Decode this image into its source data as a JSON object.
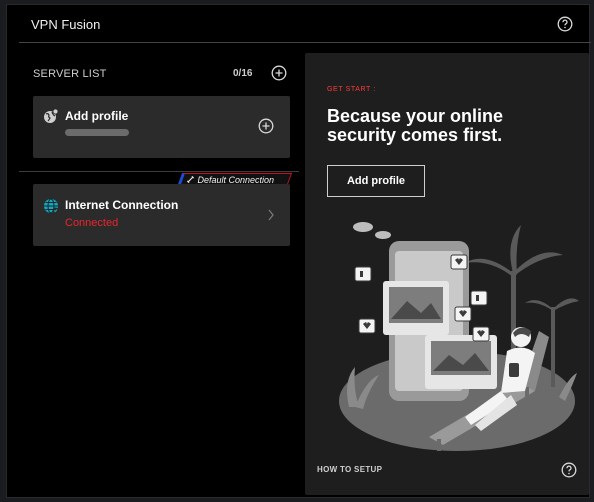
{
  "app": {
    "title": "VPN Fusion"
  },
  "server_list": {
    "label": "SERVER LIST",
    "count": "0/16",
    "add_profile_card": {
      "label": "Add profile"
    },
    "default_badge": "Default Connection",
    "connection_card": {
      "label": "Internet Connection",
      "status": "Connected"
    }
  },
  "promo": {
    "eyebrow": "GET START :",
    "headline": "Because your online security comes first.",
    "button_label": "Add profile",
    "footer_link": "HOW TO SETUP"
  },
  "colors": {
    "accent_red": "#e8262e",
    "badge_blue": "#1e4bd6",
    "card_bg": "#2b2b2b",
    "panel_bg": "#1e1e1e"
  },
  "icons": [
    "help-icon",
    "add-circle-icon",
    "profile-globe-icon",
    "internet-globe-icon",
    "chevron-right-icon",
    "link-icon"
  ]
}
